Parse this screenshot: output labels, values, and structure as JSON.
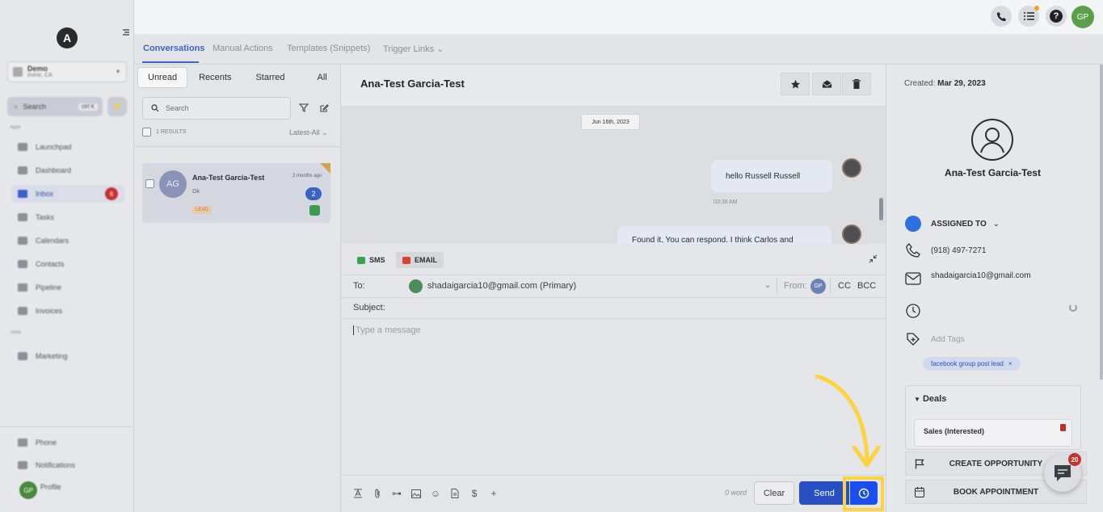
{
  "sidebar": {
    "logo": "A",
    "account": {
      "name": "Demo",
      "location": "Irvine, CA"
    },
    "search": {
      "label": "Search",
      "shortcut": "ctrl K"
    },
    "section_apps": "Apps",
    "section_tools": "Tools",
    "items": [
      {
        "label": "Launchpad",
        "icon": "rocket-icon"
      },
      {
        "label": "Dashboard",
        "icon": "grid-icon"
      },
      {
        "label": "Inbox",
        "icon": "inbox-icon",
        "badge": "6",
        "active": true
      },
      {
        "label": "Tasks",
        "icon": "tasks-icon"
      },
      {
        "label": "Calendars",
        "icon": "calendar-icon"
      },
      {
        "label": "Contacts",
        "icon": "contacts-icon"
      },
      {
        "label": "Pipeline",
        "icon": "funnel-icon"
      },
      {
        "label": "Invoices",
        "icon": "invoice-icon"
      }
    ],
    "marketing": "Marketing",
    "bottom": {
      "phone": "Phone",
      "notifications": "Notifications",
      "profile": "Profile",
      "profile_initials": "GP"
    }
  },
  "header": {
    "avatar_initials": "GP"
  },
  "nav_tabs": [
    {
      "label": "Conversations",
      "active": true
    },
    {
      "label": "Manual Actions"
    },
    {
      "label": "Templates (Snippets)"
    },
    {
      "label": "Trigger Links"
    }
  ],
  "list": {
    "filters": [
      "Unread",
      "Recents",
      "Starred",
      "All"
    ],
    "search_placeholder": "Search",
    "results": "1 RESULTS",
    "sort": "Latest-All",
    "conversation": {
      "initials": "AG",
      "name": "Ana-Test Garcia-Test",
      "time": "2 months ago",
      "snippet": "Ok",
      "count": "2",
      "tag": "LEAD"
    }
  },
  "chat": {
    "title": "Ana-Test Garcia-Test",
    "date_divider": "Jun 16th, 2023",
    "messages": [
      {
        "text": "hello Russell Russell",
        "time": "03:38 AM"
      },
      {
        "text": "Found it. You can respond. I think Carlos and"
      }
    ]
  },
  "composer": {
    "channels": {
      "sms": "SMS",
      "email": "EMAIL"
    },
    "to_label": "To:",
    "to_value": "shadaigarcia10@gmail.com (Primary)",
    "from_label": "From:",
    "from_initials": "GP",
    "cc": "CC",
    "bcc": "BCC",
    "subject_label": "Subject:",
    "placeholder": "Type a message",
    "word_count": "0 word",
    "clear": "Clear",
    "send": "Send"
  },
  "contact": {
    "created_label": "Created:",
    "created_value": "Mar 29, 2023",
    "name": "Ana-Test Garcia-Test",
    "assigned_to": "ASSIGNED TO",
    "phone": "(918) 497-7271",
    "email": "shadaigarcia10@gmail.com",
    "add_tags": "Add Tags",
    "tag": "facebook group post lead",
    "deals_title": "Deals",
    "deal_name": "Sales (Interested)",
    "create_opportunity": "CREATE OPPORTUNITY",
    "book_appointment": "BOOK APPOINTMENT",
    "chat_badge": "20"
  },
  "colors": {
    "accent": "#2850c4",
    "highlight": "#ffd23f",
    "schedule_button": "#1a4ef0"
  }
}
